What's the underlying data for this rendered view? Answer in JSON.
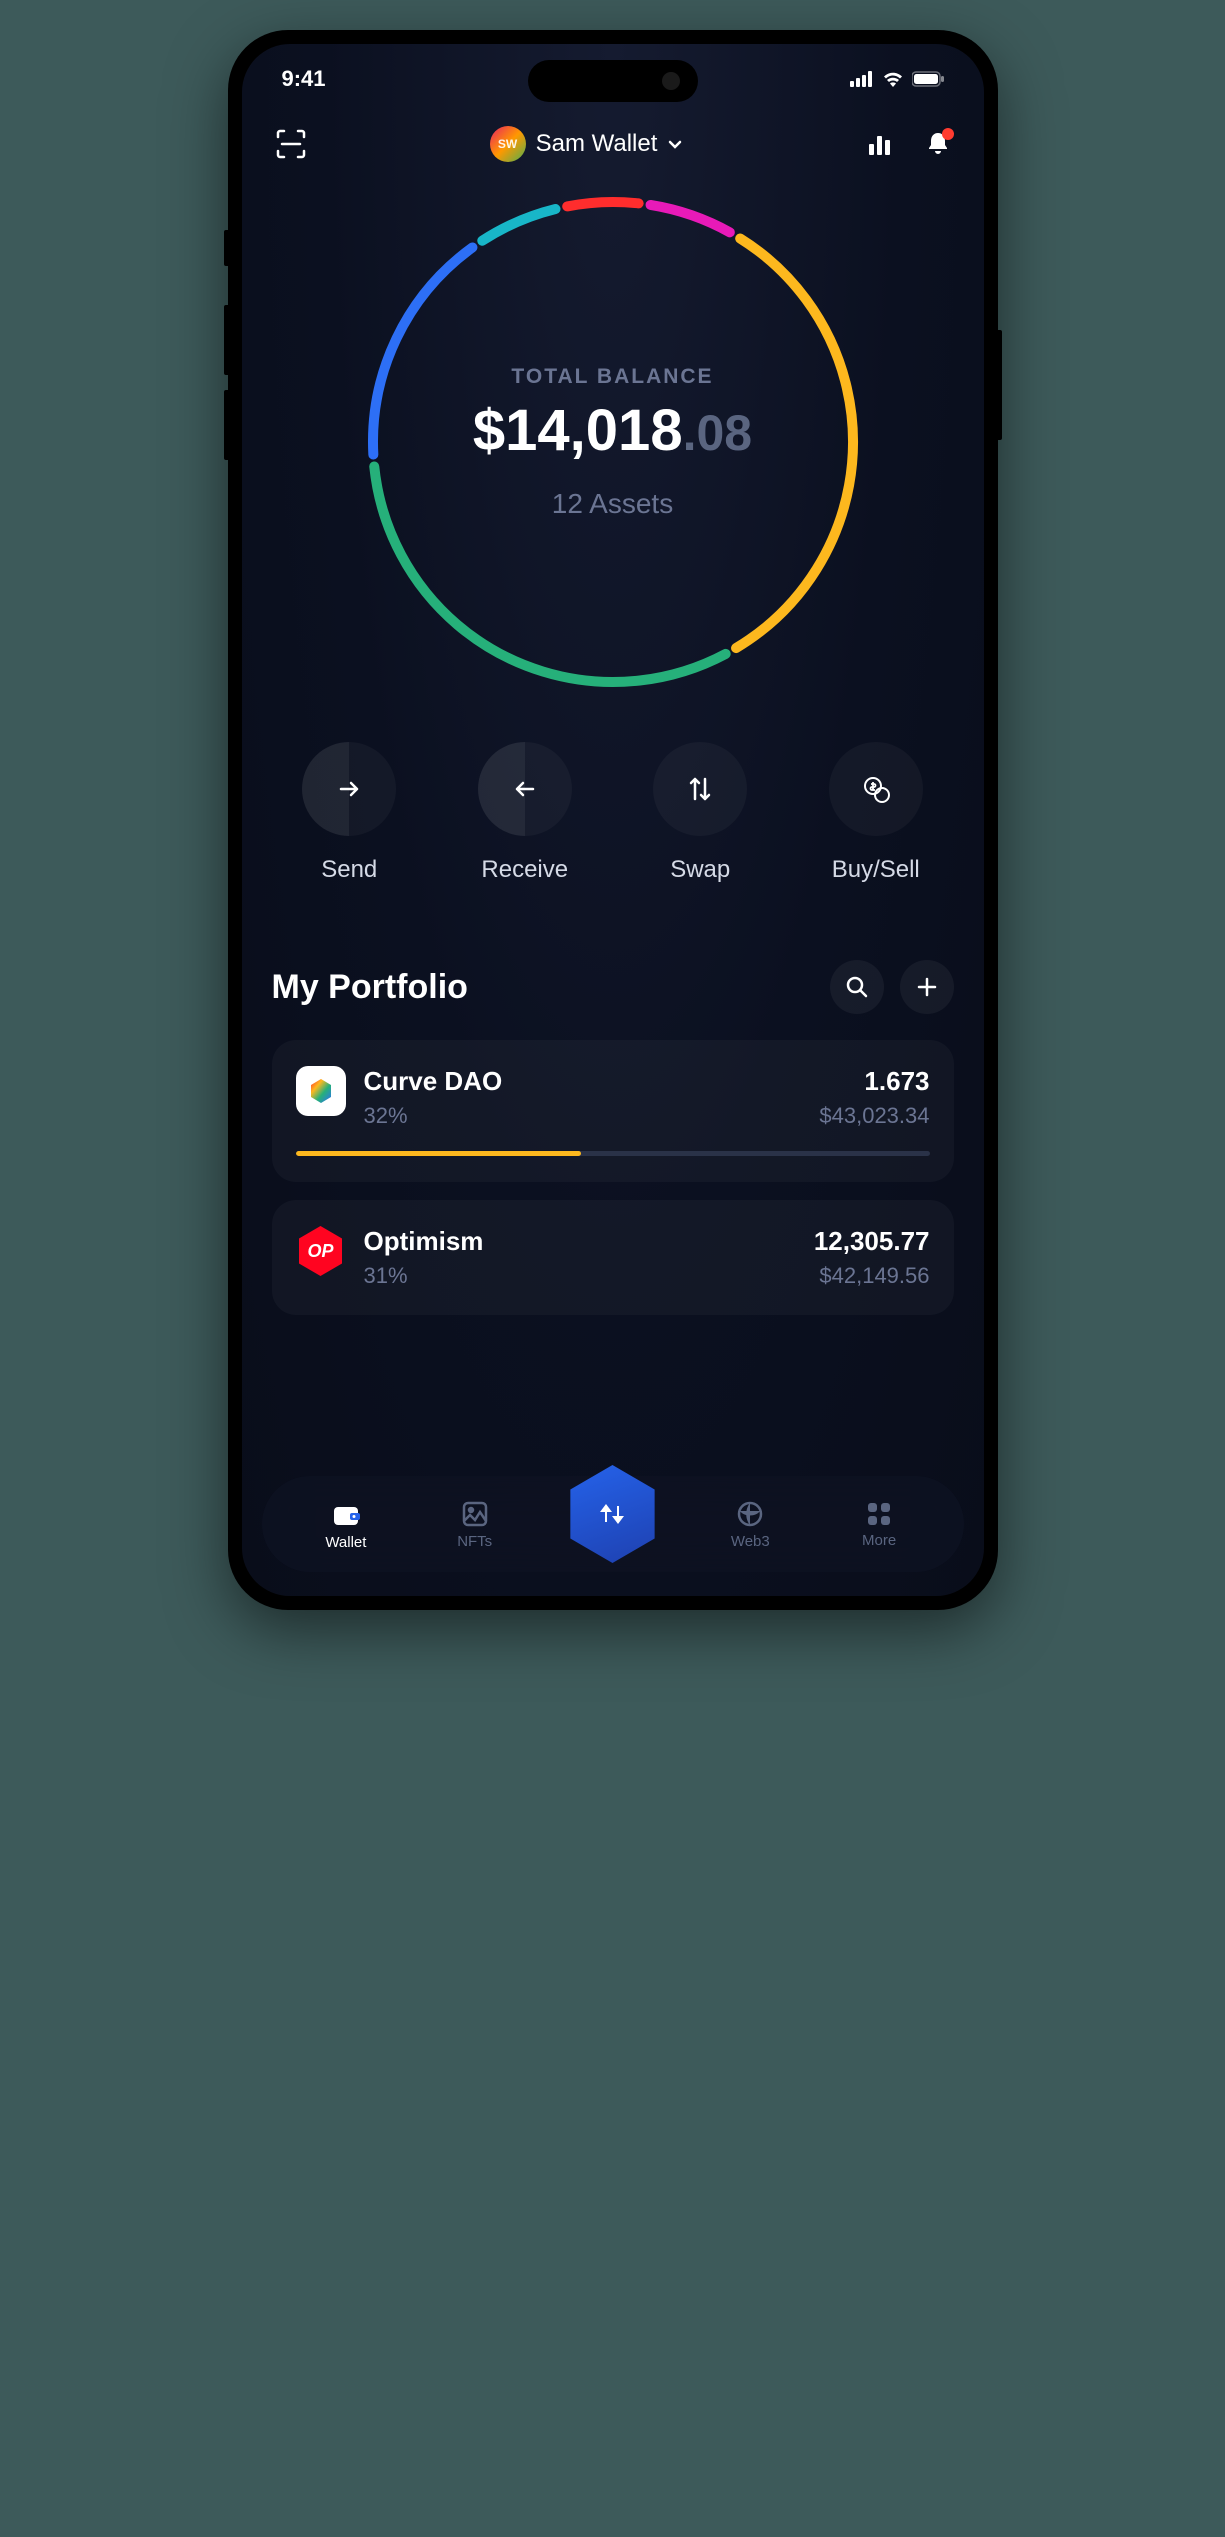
{
  "status": {
    "time": "9:41"
  },
  "header": {
    "avatar_initials": "SW",
    "wallet_name": "Sam Wallet"
  },
  "balance": {
    "label": "TOTAL BALANCE",
    "currency": "$",
    "whole": "14,018",
    "cents": ".08",
    "assets_text": "12 Assets"
  },
  "actions": {
    "send": "Send",
    "receive": "Receive",
    "swap": "Swap",
    "buy_sell": "Buy/Sell"
  },
  "portfolio": {
    "title": "My Portfolio",
    "items": [
      {
        "name": "Curve DAO",
        "pct": "32%",
        "qty": "1.673",
        "value": "$43,023.34",
        "bar_color": "#fdb81e",
        "bar_width": "45%",
        "icon": "curve"
      },
      {
        "name": "Optimism",
        "pct": "31%",
        "qty": "12,305.77",
        "value": "$42,149.56",
        "bar_color": "#ff0420",
        "bar_width": "43%",
        "icon": "op",
        "badge": "OP"
      }
    ]
  },
  "nav": {
    "wallet": "Wallet",
    "nfts": "NFTs",
    "web3": "Web3",
    "more": "More"
  },
  "ring_segments": [
    {
      "color": "#fdb81e",
      "offset": -58,
      "length": 120
    },
    {
      "color": "#26b07a",
      "offset": 62,
      "length": 115
    },
    {
      "color": "#2d6ff6",
      "offset": 177,
      "length": 60
    },
    {
      "color": "#18b6c8",
      "offset": 237,
      "length": 22
    },
    {
      "color": "#ff2d2d",
      "offset": 259,
      "length": 20
    },
    {
      "color": "#e81ab8",
      "offset": 279,
      "length": 23
    }
  ]
}
